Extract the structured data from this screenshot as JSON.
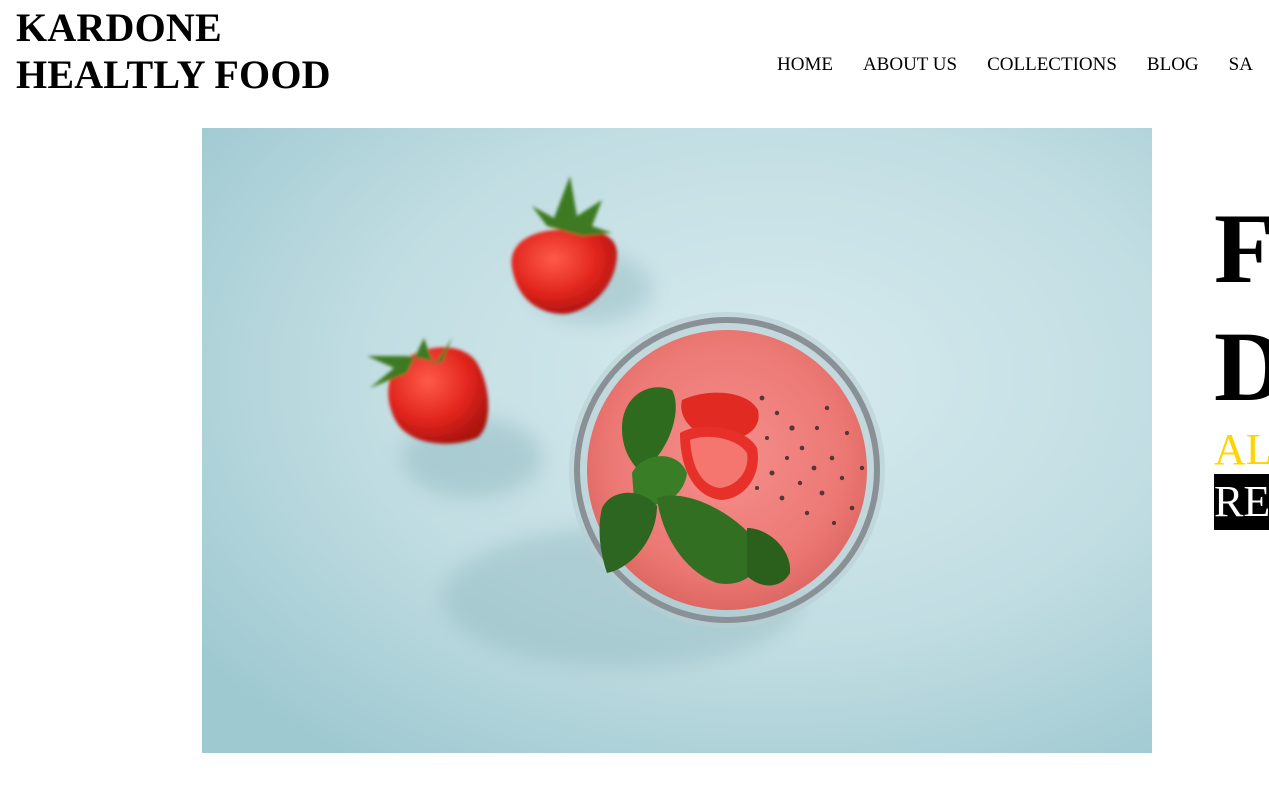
{
  "brand": {
    "line1": "KARDONE",
    "line2": "HEALTLY FOOD"
  },
  "nav": {
    "items": [
      {
        "label": "HOME"
      },
      {
        "label": "ABOUT US"
      },
      {
        "label": "COLLECTIONS"
      },
      {
        "label": "BLOG"
      },
      {
        "label": "SA"
      }
    ]
  },
  "hero": {
    "image": {
      "subject": "strawberry smoothie with mint and chia seeds, two strawberries",
      "background_color": "#c6e1e6"
    }
  },
  "promo": {
    "line1": "F",
    "line2": "D",
    "subtitle": "AL",
    "button_label": "RE",
    "accent_color": "#ffd400"
  }
}
